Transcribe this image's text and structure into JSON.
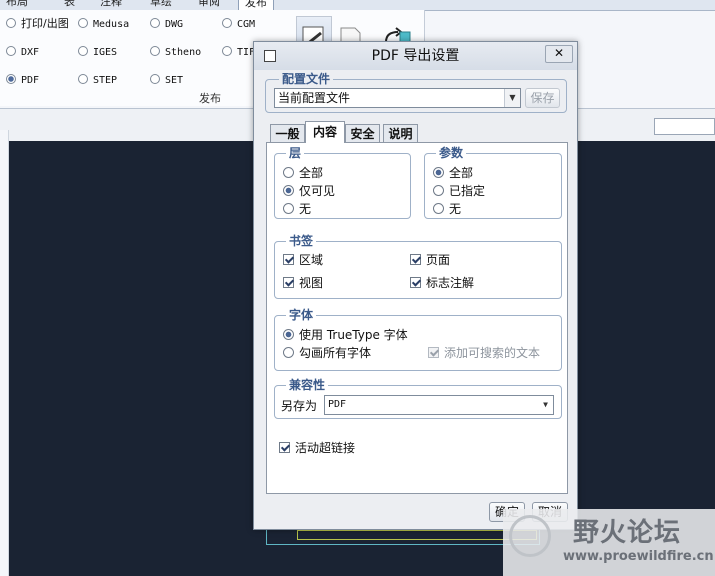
{
  "ribbon": {
    "tabs": [
      "布局",
      "表",
      "注释",
      "草绘",
      "审阅",
      "发布"
    ],
    "active_tab": "发布",
    "group_label": "发布",
    "formats": [
      {
        "label": "打印/出图",
        "mono": false,
        "selected": false
      },
      {
        "label": "DXF",
        "mono": true,
        "selected": false
      },
      {
        "label": "PDF",
        "mono": true,
        "selected": true
      },
      {
        "label": "Medusa",
        "mono": true,
        "selected": false
      },
      {
        "label": "IGES",
        "mono": true,
        "selected": false
      },
      {
        "label": "STEP",
        "mono": true,
        "selected": false
      },
      {
        "label": "DWG",
        "mono": true,
        "selected": false
      },
      {
        "label": "Stheno",
        "mono": true,
        "selected": false
      },
      {
        "label": "SET",
        "mono": true,
        "selected": false
      },
      {
        "label": "CGM",
        "mono": true,
        "selected": false
      },
      {
        "label": "TIF",
        "mono": true,
        "selected": false
      }
    ]
  },
  "dialog": {
    "title": "PDF 导出设置",
    "close_symbol": "✕",
    "profile": {
      "legend": "配置文件",
      "value": "当前配置文件",
      "save_label": "保存"
    },
    "tabs": [
      "一般",
      "内容",
      "安全",
      "说明"
    ],
    "active_tab": "内容",
    "layers": {
      "legend": "层",
      "options": [
        "全部",
        "仅可见",
        "无"
      ],
      "selected": 1
    },
    "params": {
      "legend": "参数",
      "options": [
        "全部",
        "已指定",
        "无"
      ],
      "selected": 0
    },
    "bookmarks": {
      "legend": "书签",
      "items": [
        {
          "label": "区域",
          "checked": true
        },
        {
          "label": "页面",
          "checked": true
        },
        {
          "label": "视图",
          "checked": true
        },
        {
          "label": "标志注解",
          "checked": true
        }
      ]
    },
    "fonts": {
      "legend": "字体",
      "use_truetype": "使用 TrueType 字体",
      "stroke_all": "勾画所有字体",
      "searchable_text": "添加可搜索的文本",
      "selected": 0,
      "searchable_checked": true
    },
    "compat": {
      "legend": "兼容性",
      "save_as_label": "另存为",
      "save_as_value": "PDF"
    },
    "hyperlinks": {
      "label": "活动超链接",
      "checked": true
    },
    "ok_label": "确定",
    "cancel_label": "取消"
  },
  "watermark": {
    "title": "野火论坛",
    "url": "www.proewildfire.cn"
  }
}
